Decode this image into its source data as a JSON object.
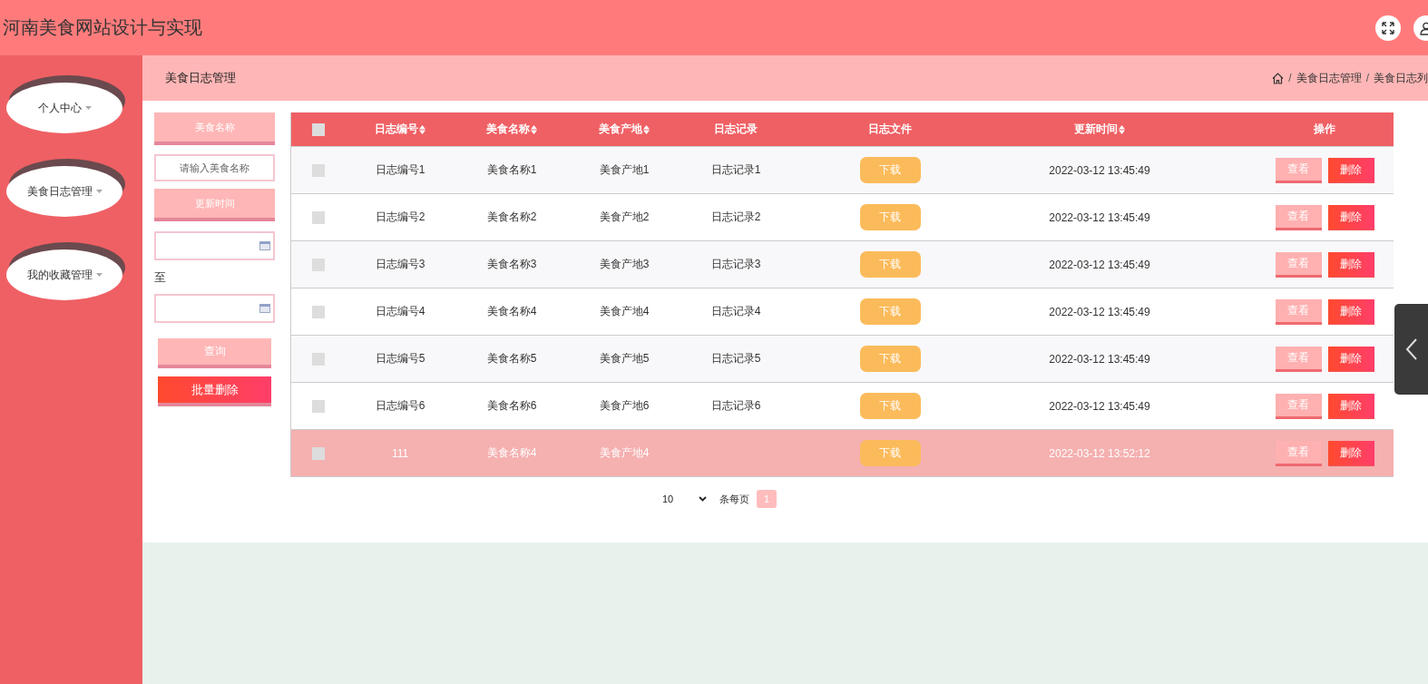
{
  "header": {
    "title": "河南美食网站设计与实现"
  },
  "sidebar": {
    "items": [
      {
        "label": "个人中心"
      },
      {
        "label": "美食日志管理"
      },
      {
        "label": "我的收藏管理"
      }
    ]
  },
  "breadcrumb": {
    "title": "美食日志管理",
    "path": [
      {
        "separator": "/",
        "label": "美食日志管理"
      },
      {
        "separator": "/",
        "label": "美食日志列"
      }
    ]
  },
  "filters": [
    {
      "kind": "label",
      "text": "美食名称"
    },
    {
      "kind": "input",
      "placeholder": "请输入美食名称"
    },
    {
      "kind": "label",
      "text": "更新时间"
    },
    {
      "kind": "date"
    },
    {
      "kind": "text",
      "text": "至"
    },
    {
      "kind": "date"
    },
    {
      "kind": "submit",
      "text": "查询"
    },
    {
      "kind": "delete",
      "text": "批量删除"
    }
  ],
  "table": {
    "select_all_checked": false,
    "columns": [
      {
        "label": "日志编号",
        "sortable": true
      },
      {
        "label": "美食名称",
        "sortable": true
      },
      {
        "label": "美食产地",
        "sortable": true
      },
      {
        "label": "日志记录",
        "sortable": false
      },
      {
        "label": "日志文件",
        "sortable": false
      },
      {
        "label": "更新时间",
        "sortable": true
      },
      {
        "label": "操作",
        "sortable": false
      }
    ],
    "rows": [
      {
        "checked": false,
        "highlighted": false,
        "log_id": "日志编号1",
        "food_name": "美食名称1",
        "origin": "美食产地1",
        "record": "日志记录1",
        "file_button": "下载",
        "updated": "2022-03-12 13:45:49",
        "actions": [
          "查看",
          "删除"
        ]
      },
      {
        "checked": false,
        "highlighted": false,
        "log_id": "日志编号2",
        "food_name": "美食名称2",
        "origin": "美食产地2",
        "record": "日志记录2",
        "file_button": "下载",
        "updated": "2022-03-12 13:45:49",
        "actions": [
          "查看",
          "删除"
        ]
      },
      {
        "checked": false,
        "highlighted": false,
        "log_id": "日志编号3",
        "food_name": "美食名称3",
        "origin": "美食产地3",
        "record": "日志记录3",
        "file_button": "下载",
        "updated": "2022-03-12 13:45:49",
        "actions": [
          "查看",
          "删除"
        ]
      },
      {
        "checked": false,
        "highlighted": false,
        "log_id": "日志编号4",
        "food_name": "美食名称4",
        "origin": "美食产地4",
        "record": "日志记录4",
        "file_button": "下载",
        "updated": "2022-03-12 13:45:49",
        "actions": [
          "查看",
          "删除"
        ]
      },
      {
        "checked": false,
        "highlighted": false,
        "log_id": "日志编号5",
        "food_name": "美食名称5",
        "origin": "美食产地5",
        "record": "日志记录5",
        "file_button": "下载",
        "updated": "2022-03-12 13:45:49",
        "actions": [
          "查看",
          "删除"
        ]
      },
      {
        "checked": false,
        "highlighted": false,
        "log_id": "日志编号6",
        "food_name": "美食名称6",
        "origin": "美食产地6",
        "record": "日志记录6",
        "file_button": "下载",
        "updated": "2022-03-12 13:45:49",
        "actions": [
          "查看",
          "删除"
        ]
      },
      {
        "checked": false,
        "highlighted": true,
        "log_id": "111",
        "food_name": "美食名称4",
        "origin": "美食产地4",
        "file_button": "下载",
        "updated": "2022-03-12 13:52:12",
        "actions": [
          "查看",
          "删除"
        ]
      }
    ]
  },
  "pagination": {
    "page_size": "10",
    "page_size_label": "条每页",
    "pages": [
      {
        "label": "1",
        "selected": true
      }
    ]
  }
}
